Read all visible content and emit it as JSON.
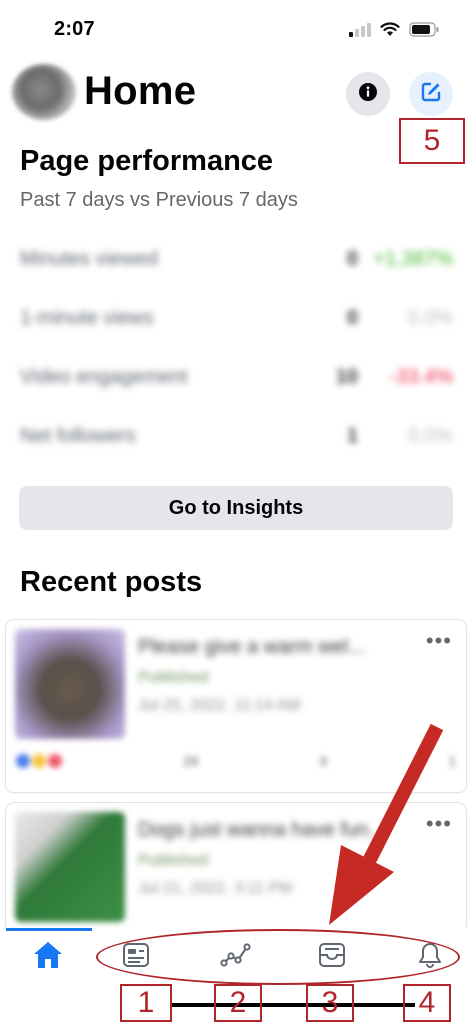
{
  "status_bar": {
    "time": "2:07"
  },
  "header": {
    "title": "Home",
    "info_icon": "info-icon",
    "edit_icon": "edit-icon"
  },
  "page_performance": {
    "title": "Page performance",
    "subtitle": "Past 7 days vs Previous 7 days",
    "metrics": [
      {
        "label": "Minutes viewed",
        "value": "0",
        "change": "+1,387%",
        "change_color": "#42b72a"
      },
      {
        "label": "1-minute views",
        "value": "0",
        "change": "0.0%",
        "change_color": "#bcc0c4"
      },
      {
        "label": "Video engagement",
        "value": "10",
        "change": "-33.4%",
        "change_color": "#f02849"
      },
      {
        "label": "Net followers",
        "value": "1",
        "change": "0.0%",
        "change_color": "#bcc0c4"
      }
    ],
    "insights_button": "Go to Insights"
  },
  "recent_posts": {
    "title": "Recent posts",
    "posts": [
      {
        "caption": "Please give a warm wel...",
        "status": "Published",
        "date": "Jul 25, 2022, 11:14 AM",
        "more": "•••",
        "stats": [
          "28",
          "9",
          "1"
        ]
      },
      {
        "caption": "Dogs just wanna have fun...",
        "status": "Published",
        "date": "Jul 21, 2022, 3:11 PM",
        "more": "•••"
      }
    ]
  },
  "tab_bar": {
    "tabs": [
      {
        "name": "home-icon",
        "active": true
      },
      {
        "name": "posts-icon",
        "active": false
      },
      {
        "name": "insights-icon",
        "active": false
      },
      {
        "name": "inbox-icon",
        "active": false
      },
      {
        "name": "notifications-icon",
        "active": false
      }
    ]
  },
  "annotations": {
    "labels": [
      "1",
      "2",
      "3",
      "4",
      "5"
    ],
    "color": "#b0252a"
  },
  "colors": {
    "accent": "#1877f2",
    "annotation": "#b0252a"
  }
}
